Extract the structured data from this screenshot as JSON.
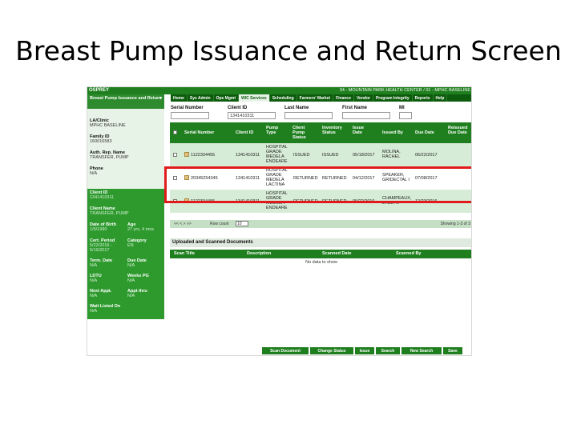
{
  "slide": {
    "title": "Breast Pump Issuance and Return Screen"
  },
  "app": {
    "logo_text": "OSPREY",
    "clinic_title": "34 - MOUNTAIN PARK HEALTH CENTER / 01 - MPHC BASELINE"
  },
  "nav": [
    "Home",
    "Sys Admin",
    "Ops Mgmt",
    "WIC Services",
    "Scheduling",
    "Farmers' Market",
    "Finance",
    "Vendor",
    "Program Integrity",
    "Reports",
    "Help"
  ],
  "sidebar": {
    "header": "Breast Pump Issuance and Return",
    "la_clinic_label": "LA/Clinic",
    "la_clinic_value": "MPHC BASELINE",
    "family_id_label": "Family ID",
    "family_id_value": "160016583",
    "auth_rep_label": "Auth. Rep. Name",
    "auth_rep_value": "TRANSFER, PUMP",
    "phone_label": "Phone",
    "phone_value": "N/A",
    "client_id_label": "Client ID",
    "client_id_value": "1341410311",
    "client_name_label": "Client Name",
    "client_name_value": "TRANSFER, PUMP",
    "dob_label": "Date of Birth",
    "dob_value": "1/5/1990",
    "age_label": "Age",
    "age_value": "27 yrs, 4 mos",
    "cert_label": "Cert. Period",
    "cert_value": "5/22/2016 - 5/19/2017",
    "category_label": "Category",
    "category_value": "EN",
    "term_label": "Term. Date",
    "term_value": "N/A",
    "due_label": "Due Date",
    "due_value": "N/A",
    "ldtu_label": "LDTU",
    "ldtu_value": "N/A",
    "weeks_label": "Weeks PG",
    "weeks_value": "N/A",
    "next_appt_label": "Next Appt.",
    "next_appt_value": "N/A",
    "appt_thru_label": "Appt thru",
    "appt_thru_value": "N/A",
    "wait_label": "Wait Listed On",
    "wait_value": "N/A"
  },
  "search": {
    "serial_label": "Serial Number",
    "client_id_label": "Client ID",
    "client_id_value": "1341410311",
    "last_name_label": "Last Name",
    "first_name_label": "First Name",
    "mi_label": "MI"
  },
  "grid": {
    "headers": [
      "Serial Number",
      "Client ID",
      "Pump Type",
      "Client Pump Status",
      "Inventory Status",
      "Issue Date",
      "Issued By",
      "Due Date",
      "Reissued Due Date"
    ],
    "rows": [
      {
        "serial": "1122334455",
        "client_id": "1341410311",
        "pump_type": "HOSPITAL GRADE MEDELA ENDEARE",
        "client_status": "ISSUED",
        "inventory": "ISSUED",
        "issue_date": "05/18/2017",
        "issued_by": "MOLINA, RACHEL",
        "due_date": "06/22/2017",
        "reissued": ""
      },
      {
        "serial": "20345254345",
        "client_id": "1341410311",
        "pump_type": "HOSPITAL GRADE MEDELA LACTINA",
        "client_status": "RETURNED",
        "inventory": "RETURNED",
        "issue_date": "04/12/2017",
        "issued_by": "SPEAKER, GRIDECTAL I",
        "due_date": "07/08/2017",
        "reissued": ""
      },
      {
        "serial": "1122334455",
        "client_id": "1341410311",
        "pump_type": "HOSPITAL GRADE MEDELA ENDEARE",
        "client_status": "RETURNED",
        "inventory": "RETURNED",
        "issue_date": "09/22/2016",
        "issued_by": "CHAMPEAUX, JACLYN",
        "due_date": "12/23/2016",
        "reissued": ""
      }
    ]
  },
  "pager": {
    "controls": "<< < > >>",
    "rows_label": "Row count",
    "rows_value": "10",
    "showing": "Showing 1-3 of 3"
  },
  "documents": {
    "title": "Uploaded and Scanned Documents",
    "headers": [
      "Scan Title",
      "Description",
      "Scanned Date",
      "Scanned By"
    ],
    "empty": "No data to show"
  },
  "buttons": [
    "Scan Document",
    "Change Status",
    "Issue",
    "Search",
    "New Search",
    "Save"
  ],
  "colors": {
    "primary_green": "#1f7f1f",
    "highlight_red": "#e11b1b"
  }
}
